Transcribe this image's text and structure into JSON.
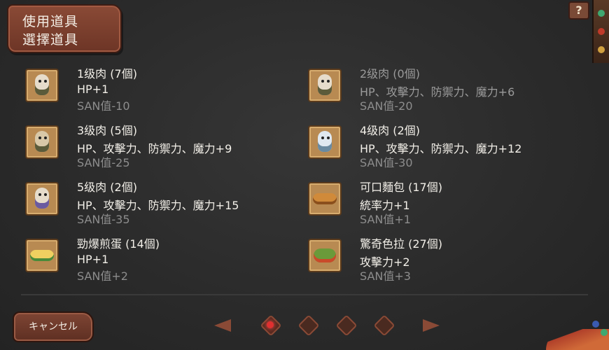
{
  "header": {
    "line1": "使用道具",
    "line2": "選擇道具",
    "help_label": "?"
  },
  "items": [
    {
      "name": "1级肉 (7個)",
      "stat": "HP+1",
      "san": "SAN值-10",
      "icon": "skull-meat-icon",
      "enabled": true
    },
    {
      "name": "2级肉 (0個)",
      "stat": "HP、攻擊力、防禦力、魔力+6",
      "san": "SAN值-20",
      "icon": "skull-meat-icon",
      "enabled": false
    },
    {
      "name": "3级肉 (5個)",
      "stat": "HP、攻擊力、防禦力、魔力+9",
      "san": "SAN值-25",
      "icon": "skull-meat-icon",
      "enabled": true
    },
    {
      "name": "4级肉 (2個)",
      "stat": "HP、攻擊力、防禦力、魔力+12",
      "san": "SAN值-30",
      "icon": "skull-meat-icon",
      "enabled": true
    },
    {
      "name": "5级肉 (2個)",
      "stat": "HP、攻擊力、防禦力、魔力+15",
      "san": "SAN值-35",
      "icon": "skull-meat-icon",
      "enabled": true
    },
    {
      "name": "可口麵包 (17個)",
      "stat": "統率力+1",
      "san": "SAN值+1",
      "icon": "bread-icon",
      "enabled": true
    },
    {
      "name": "勁爆煎蛋 (14個)",
      "stat": "HP+1",
      "san": "SAN值+2",
      "icon": "fried-egg-icon",
      "enabled": true
    },
    {
      "name": "驚奇色拉 (27個)",
      "stat": "攻擊力+2",
      "san": "SAN值+3",
      "icon": "salad-icon",
      "enabled": true
    }
  ],
  "footer": {
    "cancel_label": "キャンセル",
    "pagination": {
      "pages": 4,
      "current": 1
    }
  },
  "colors": {
    "accent": "#8a4a36",
    "active_page": "#e03030",
    "text": "#f2efe8",
    "muted": "#8d8d8d"
  }
}
